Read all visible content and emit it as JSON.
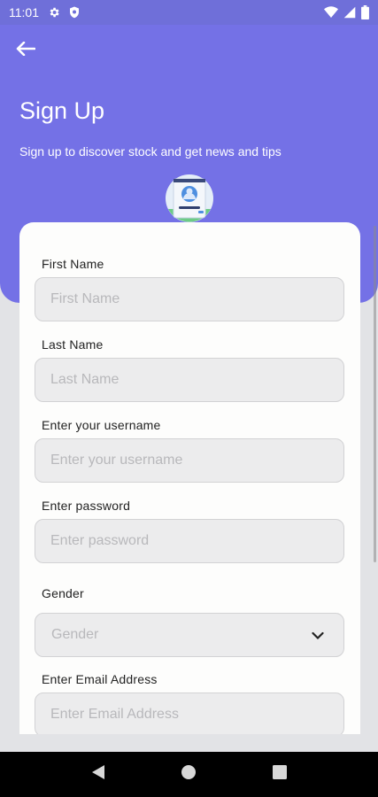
{
  "status_bar": {
    "time": "11:01"
  },
  "header": {
    "title": "Sign Up",
    "subtitle": "Sign up to discover stock and get news and tips"
  },
  "form": {
    "first_name": {
      "label": "First Name",
      "placeholder": "First Name"
    },
    "last_name": {
      "label": "Last Name",
      "placeholder": "Last Name"
    },
    "username": {
      "label": "Enter your username",
      "placeholder": "Enter your username"
    },
    "password": {
      "label": "Enter password",
      "placeholder": "Enter password"
    },
    "gender": {
      "label": "Gender",
      "placeholder": "Gender"
    },
    "email": {
      "label": "Enter Email Address",
      "placeholder": "Enter Email Address"
    }
  },
  "colors": {
    "header": "#7471e6",
    "status_bar": "#6f6fd9",
    "page_background": "#e2e3e6",
    "card": "#fdfdfc",
    "field": "#ececed"
  },
  "icons": [
    "settings-icon",
    "shield-icon",
    "wifi-icon",
    "signal-icon",
    "battery-icon",
    "back-arrow-icon",
    "profile-illustration-icon",
    "chevron-down-icon",
    "nav-back-icon",
    "nav-home-icon",
    "nav-recents-icon"
  ]
}
